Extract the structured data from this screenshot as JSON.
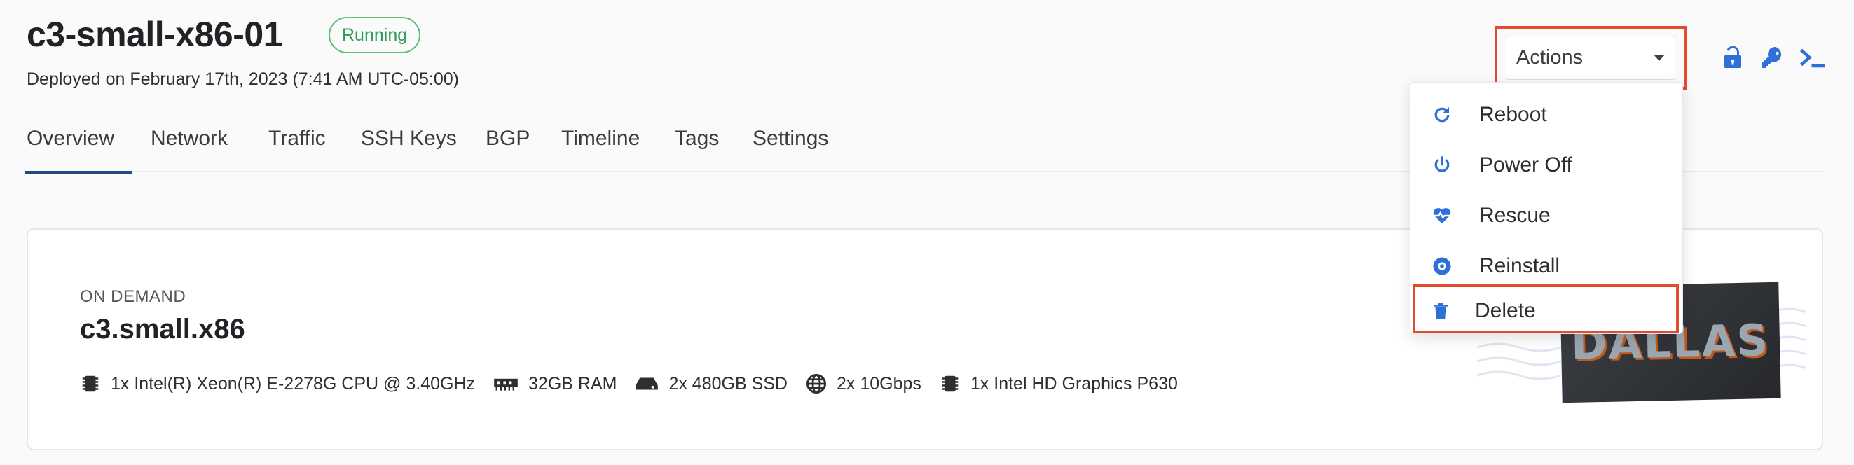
{
  "header": {
    "title": "c3-small-x86-01",
    "status": "Running",
    "deployed": "Deployed on February 17th, 2023 (7:41 AM UTC-05:00)"
  },
  "tabs": [
    {
      "label": "Overview",
      "active": true
    },
    {
      "label": "Network"
    },
    {
      "label": "Traffic"
    },
    {
      "label": "SSH Keys"
    },
    {
      "label": "BGP"
    },
    {
      "label": "Timeline"
    },
    {
      "label": "Tags"
    },
    {
      "label": "Settings"
    }
  ],
  "actions": {
    "label": "Actions",
    "menu": [
      {
        "label": "Reboot",
        "icon": "refresh-icon"
      },
      {
        "label": "Power Off",
        "icon": "power-icon"
      },
      {
        "label": "Rescue",
        "icon": "heart-pulse-icon"
      },
      {
        "label": "Reinstall",
        "icon": "disc-icon"
      },
      {
        "label": "Delete",
        "icon": "trash-icon"
      }
    ]
  },
  "toolbar_icons": [
    "unlock-icon",
    "key-icon",
    "terminal-icon"
  ],
  "card": {
    "tag": "ON DEMAND",
    "plan": "c3.small.x86",
    "specs": [
      {
        "icon": "cpu-icon",
        "label": "1x Intel(R) Xeon(R) E-2278G CPU @ 3.40GHz"
      },
      {
        "icon": "memory-icon",
        "label": "32GB RAM"
      },
      {
        "icon": "drive-icon",
        "label": "2x 480GB SSD"
      },
      {
        "icon": "globe-icon",
        "label": "2x 10Gbps"
      },
      {
        "icon": "gpu-icon",
        "label": "1x Intel HD Graphics P630"
      }
    ],
    "location_art_text": "DALLAS"
  },
  "colors": {
    "accent": "#1e4c8a",
    "icon_blue": "#2f6fd8",
    "running_green": "#2f9a55",
    "highlight_red": "#e34b2f"
  }
}
